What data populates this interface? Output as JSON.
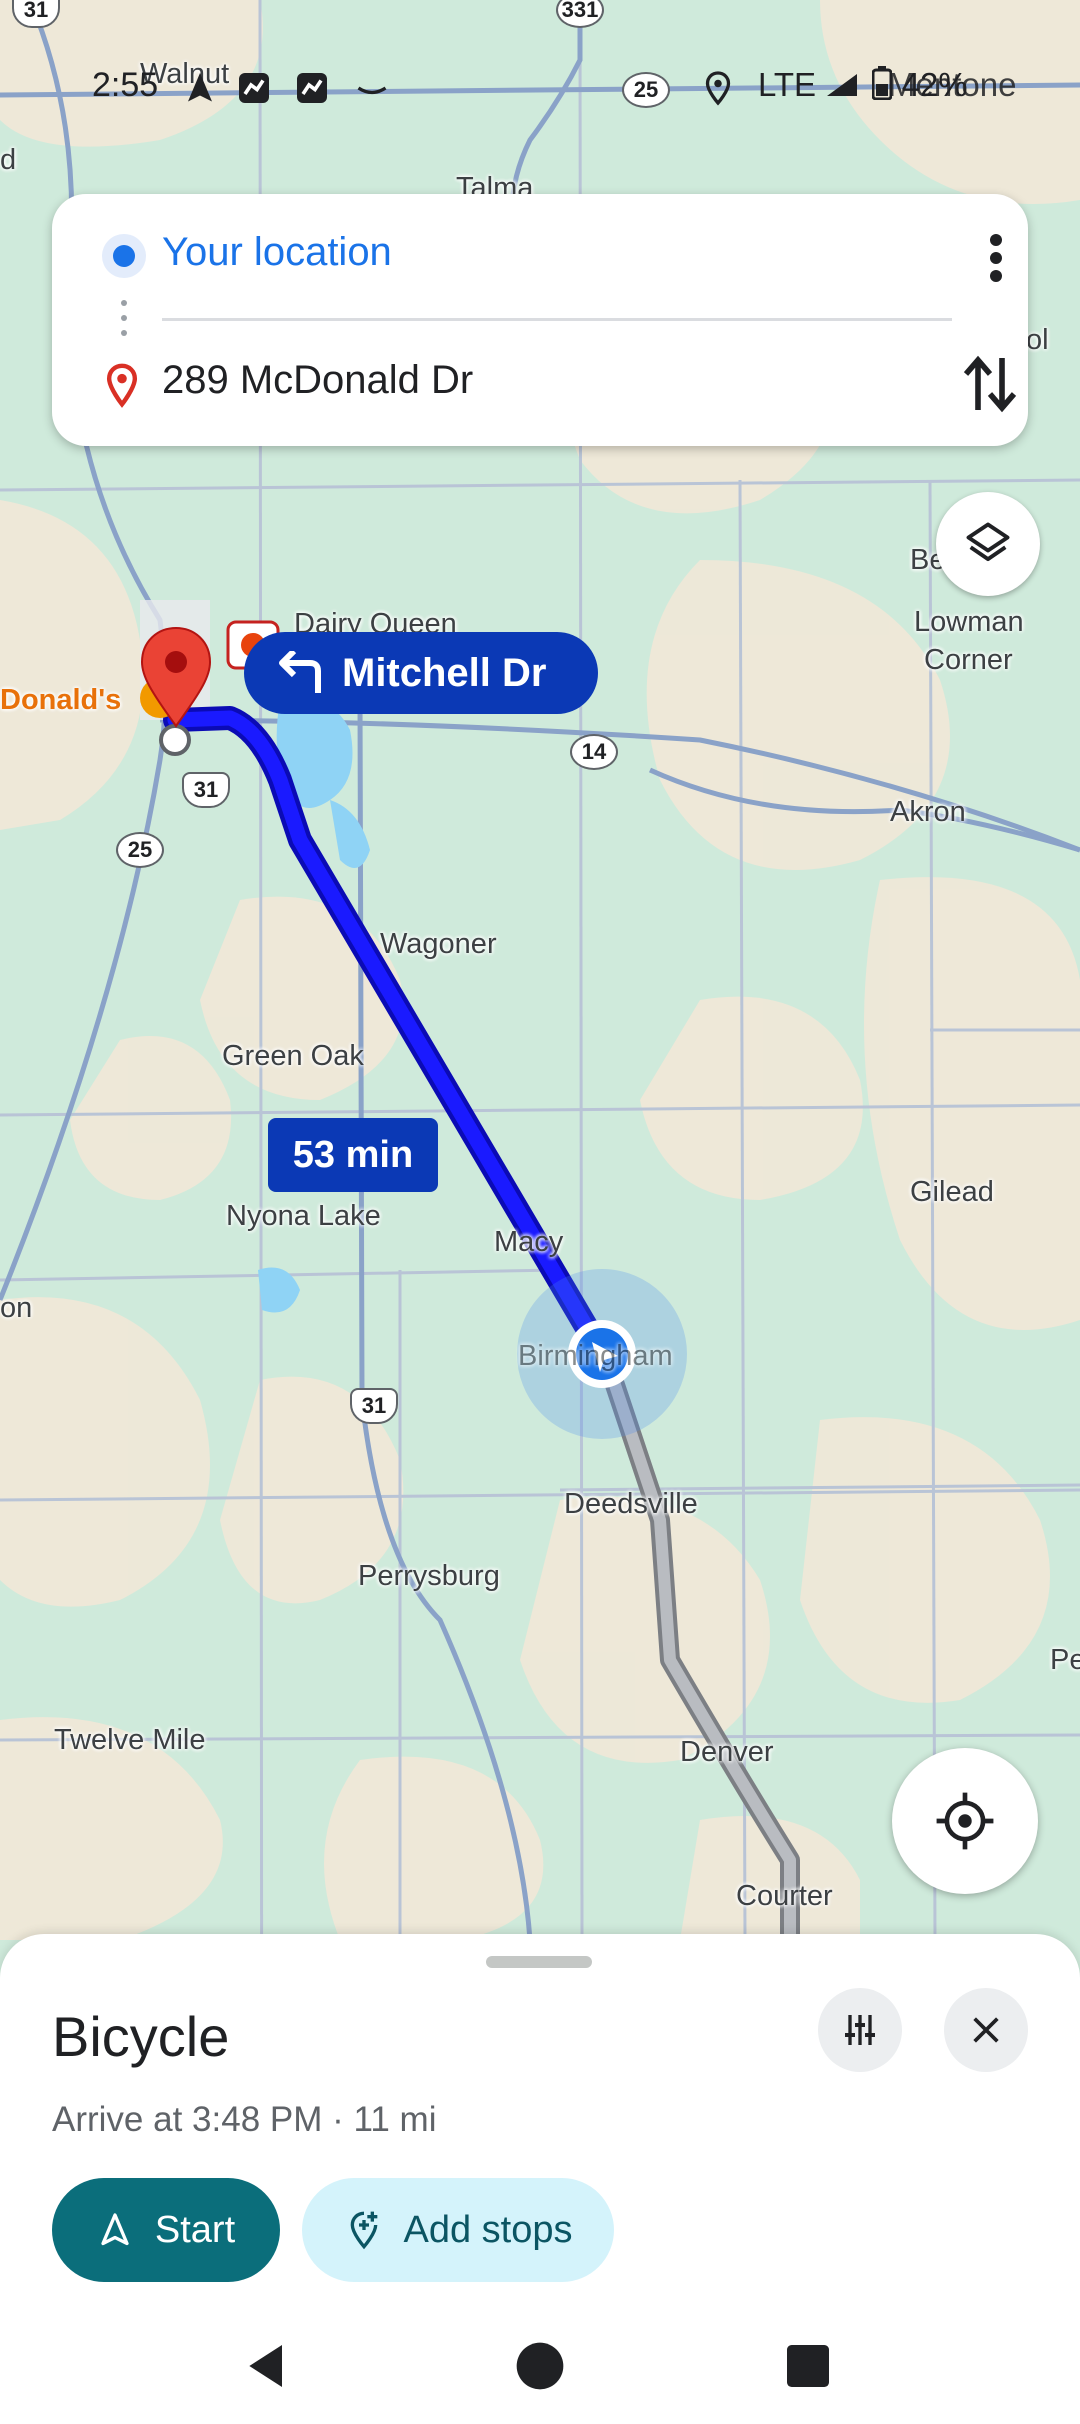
{
  "status_bar": {
    "time": "2:55",
    "network": "LTE",
    "overlap_text": "Walnut",
    "battery_overlap": "Mentone",
    "battery": "42%"
  },
  "route_card": {
    "origin": "Your location",
    "destination": "289 McDonald Dr"
  },
  "map": {
    "labels": {
      "walnut": "Walnut",
      "talma": "Talma",
      "dairy_queen": "Dairy Queen",
      "mcdonalds": "Donald's",
      "beaver_dam": "Be        am",
      "lowman_corner_1": "Lowman",
      "lowman_corner_2": "Corner",
      "akron": "Akron",
      "wagoner": "Wagoner",
      "green_oak": "Green Oak",
      "nyona_lake": "Nyona Lake",
      "macy": "Macy",
      "gilead": "Gilead",
      "birmingham": "Birmingham",
      "deedsville": "Deedsville",
      "perrysburg": "Perrysburg",
      "twelve_mile": "Twelve Mile",
      "denver": "Denver",
      "courter": "Courter",
      "edge_ol": "ol",
      "edge_on": "on",
      "edge_pe": "Pe",
      "edge_d": "d"
    },
    "shields": {
      "us31_top": "31",
      "sr331": "331",
      "sr25_top": "25",
      "sr14": "14",
      "us31_mid": "31",
      "sr25_left": "25",
      "us31_low": "31"
    },
    "turn_instruction": "Mitchell Dr",
    "duration": "53 min",
    "colors": {
      "route": "#1a1aff",
      "route_outline": "#0b0bb5",
      "alt_route": "#9aa0a6",
      "callout": "#0b39b5"
    }
  },
  "sheet": {
    "mode": "Bicycle",
    "summary": "Arrive at 3:48 PM · 11 mi",
    "start_label": "Start",
    "add_stops_label": "Add stops"
  },
  "icons": {
    "origin": "blue-dot-icon",
    "destination": "red-pin-icon",
    "more": "more-vert-icon",
    "swap": "swap-vert-icon",
    "layers": "layers-icon",
    "locate": "my-location-icon",
    "options": "tune-icon",
    "close": "close-icon",
    "start": "navigation-arrow-icon",
    "add_stops": "add-location-icon",
    "turn": "turn-left-icon"
  }
}
